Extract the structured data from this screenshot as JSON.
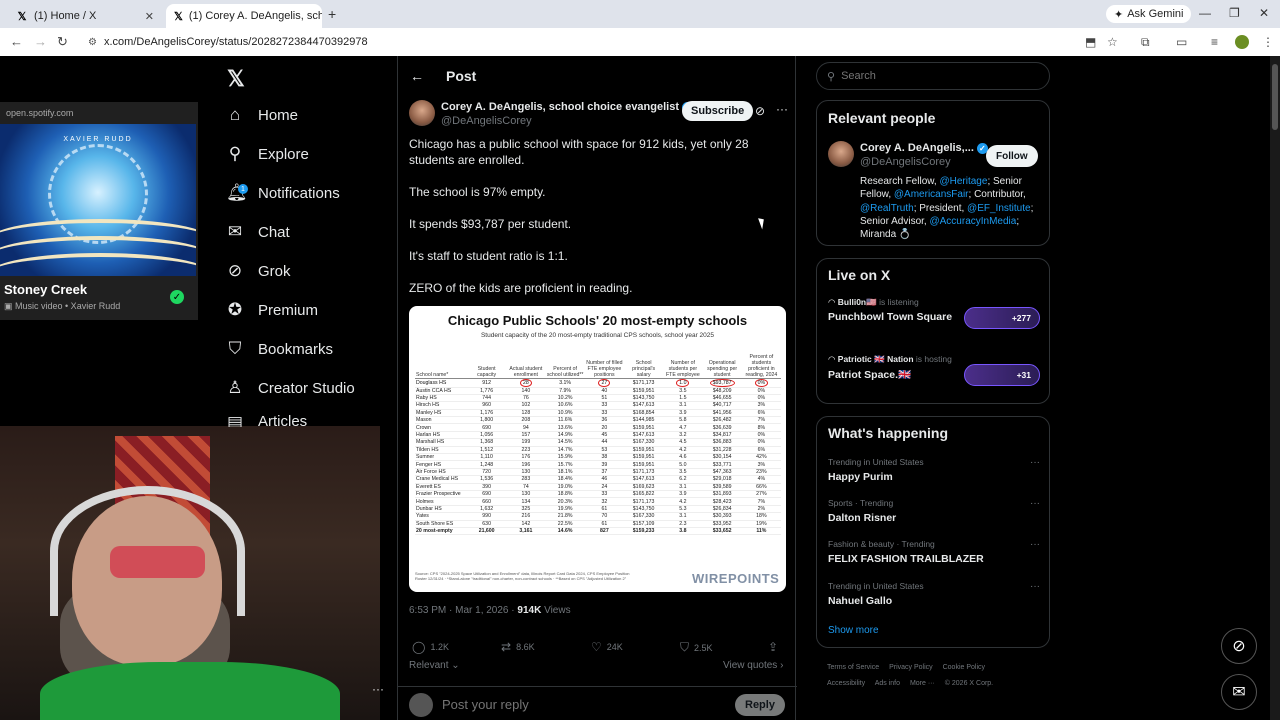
{
  "browser": {
    "tabs": [
      {
        "title": "(1) Home / X"
      },
      {
        "title": "(1) Corey A. DeAngelis, school c"
      }
    ],
    "ask_gemini": "Ask Gemini",
    "url": "x.com/DeAngelisCorey/status/2028272384470392978"
  },
  "pip": {
    "url": "open.spotify.com",
    "album_text": "XAVIER RUDD",
    "title": "Stoney Creek",
    "subtitle": "Music video • Xavier Rudd"
  },
  "nav": {
    "items": [
      {
        "label": "Home",
        "icon": "home-icon"
      },
      {
        "label": "Explore",
        "icon": "search-icon"
      },
      {
        "label": "Notifications",
        "icon": "bell-icon",
        "badge": "1"
      },
      {
        "label": "Chat",
        "icon": "mail-icon"
      },
      {
        "label": "Grok",
        "icon": "grok-icon"
      },
      {
        "label": "Premium",
        "icon": "premium-icon"
      },
      {
        "label": "Bookmarks",
        "icon": "bookmark-icon"
      },
      {
        "label": "Creator Studio",
        "icon": "creator-icon"
      },
      {
        "label": "Articles",
        "icon": "articles-icon"
      }
    ]
  },
  "post": {
    "header": "Post",
    "author_name": "Corey A. DeAngelis, school choice evangelist",
    "author_handle": "@DeAngelisCorey",
    "subscribe": "Subscribe",
    "paragraphs": [
      "Chicago has a public school with space for 912 kids, yet only 28 students are enrolled.",
      "The school is 97% empty.",
      "It spends $93,787 per student.",
      "It's staff to student ratio is 1:1.",
      "ZERO of the kids are proficient in reading."
    ],
    "image": {
      "title": "Chicago Public Schools' 20 most-empty schools",
      "subtitle": "Student capacity of the 20 most-empty traditional CPS schools, school year 2025",
      "headers": [
        "School name*",
        "Student capacity",
        "Actual student enrollment",
        "Percent of school utilized**",
        "Number of filled FTE employee positions",
        "School principal's salary",
        "Number of students per FTE employee",
        "Operational spending per student",
        "Percent of students proficient in reading, 2024"
      ],
      "rows": [
        [
          "Douglass HS",
          "912",
          "28",
          "3.1%",
          "27",
          "$171,173",
          "1.0",
          "$93,787",
          "0%"
        ],
        [
          "Austin CCA HS",
          "1,776",
          "140",
          "7.9%",
          "40",
          "$159,951",
          "3.5",
          "$48,209",
          "0%"
        ],
        [
          "Raby HS",
          "744",
          "76",
          "10.2%",
          "51",
          "$143,750",
          "1.5",
          "$46,655",
          "0%"
        ],
        [
          "Hirsch HS",
          "960",
          "102",
          "10.6%",
          "33",
          "$147,613",
          "3.1",
          "$40,717",
          "3%"
        ],
        [
          "Manley HS",
          "1,176",
          "128",
          "10.9%",
          "33",
          "$168,854",
          "3.9",
          "$41,956",
          "6%"
        ],
        [
          "Mason",
          "1,800",
          "208",
          "11.6%",
          "36",
          "$144,985",
          "5.8",
          "$26,482",
          "7%"
        ],
        [
          "Crown",
          "690",
          "94",
          "13.6%",
          "20",
          "$159,951",
          "4.7",
          "$36,639",
          "8%"
        ],
        [
          "Harlan HS",
          "1,056",
          "157",
          "14.9%",
          "45",
          "$147,613",
          "3.2",
          "$34,817",
          "0%"
        ],
        [
          "Marshall HS",
          "1,368",
          "199",
          "14.5%",
          "44",
          "$167,330",
          "4.5",
          "$36,883",
          "0%"
        ],
        [
          "Tilden HS",
          "1,512",
          "223",
          "14.7%",
          "53",
          "$159,951",
          "4.2",
          "$31,228",
          "6%"
        ],
        [
          "Sumner",
          "1,110",
          "176",
          "15.9%",
          "38",
          "$159,951",
          "4.6",
          "$30,154",
          "42%"
        ],
        [
          "Fenger HS",
          "1,248",
          "196",
          "15.7%",
          "39",
          "$159,951",
          "5.0",
          "$33,771",
          "3%"
        ],
        [
          "Air Force HS",
          "720",
          "130",
          "18.1%",
          "37",
          "$171,173",
          "3.5",
          "$47,363",
          "23%"
        ],
        [
          "Crane Medical HS",
          "1,536",
          "283",
          "18.4%",
          "46",
          "$147,613",
          "6.2",
          "$29,018",
          "4%"
        ],
        [
          "Everett ES",
          "390",
          "74",
          "19.0%",
          "24",
          "$169,623",
          "3.1",
          "$39,589",
          "66%"
        ],
        [
          "Frazier Prospective",
          "690",
          "130",
          "18.8%",
          "33",
          "$165,822",
          "3.9",
          "$31,893",
          "27%"
        ],
        [
          "Holmes",
          "660",
          "134",
          "20.3%",
          "32",
          "$171,173",
          "4.2",
          "$28,423",
          "7%"
        ],
        [
          "Dunbar HS",
          "1,632",
          "325",
          "19.9%",
          "61",
          "$143,750",
          "5.3",
          "$26,834",
          "2%"
        ],
        [
          "Yates",
          "990",
          "216",
          "21.8%",
          "70",
          "$167,330",
          "3.1",
          "$30,393",
          "18%"
        ],
        [
          "South Shore ES",
          "630",
          "142",
          "22.5%",
          "61",
          "$157,109",
          "2.3",
          "$33,952",
          "19%"
        ]
      ],
      "total": [
        "20 most-empty",
        "21,600",
        "3,161",
        "14.6%",
        "827",
        "$159,233",
        "3.8",
        "$33,652",
        "11%"
      ],
      "source": "Source: CPS \"2024-2025 Space Utilization and Enrollment\" data, Illinois Report Card Data 2024, CPS Employee Position Roster 12/31/24 · *Stand-alone \"traditional\" non-charter, non-contract schools · **Based on CPS \"Adjusted Utilization 2\"",
      "brand": "WIREPOINTS"
    },
    "time": "6:53 PM · Mar 1, 2026 · ",
    "views_count": "914K",
    "views_label": " Views",
    "actions": {
      "replies": "1.2K",
      "reposts": "8.6K",
      "likes": "24K",
      "bookmarks": "2.5K"
    },
    "sort_label": "Relevant",
    "view_quotes": "View quotes",
    "reply_placeholder": "Post your reply",
    "reply_button": "Reply"
  },
  "right": {
    "search_placeholder": "Search",
    "relevant_people": {
      "title": "Relevant people",
      "name": "Corey A. DeAngelis,...",
      "handle": "@DeAngelisCorey",
      "follow": "Follow",
      "bio_parts": [
        "Research Fellow, ",
        "@Heritage",
        "; Senior Fellow, ",
        "@AmericansFair",
        "; Contributor, ",
        "@RealTruth",
        "; President, ",
        "@EF_Institute",
        "; Senior Advisor, ",
        "@AccuracyInMedia",
        "; Miranda 💍"
      ]
    },
    "live": {
      "title": "Live on X",
      "items": [
        {
          "host": "Bulli0n🇺🇸",
          "status": "is listening",
          "name": "Punchbowl Town Square",
          "count": "+277"
        },
        {
          "host": "Patriotic 🇬🇧 Nation",
          "status": "is hosting",
          "name": "Patriot Space.🇬🇧",
          "count": "+31"
        }
      ]
    },
    "happening": {
      "title": "What's happening",
      "trends": [
        {
          "category": "Trending in United States",
          "name": "Happy Purim"
        },
        {
          "category": "Sports · Trending",
          "name": "Dalton Risner"
        },
        {
          "category": "Fashion & beauty · Trending",
          "name": "FELIX FASHION TRAILBLAZER"
        },
        {
          "category": "Trending in United States",
          "name": "Nahuel Gallo"
        }
      ],
      "show_more": "Show more"
    },
    "footer": [
      "Terms of Service",
      "Privacy Policy",
      "Cookie Policy",
      "Accessibility",
      "Ads info",
      "More ···",
      "© 2026 X Corp."
    ]
  }
}
